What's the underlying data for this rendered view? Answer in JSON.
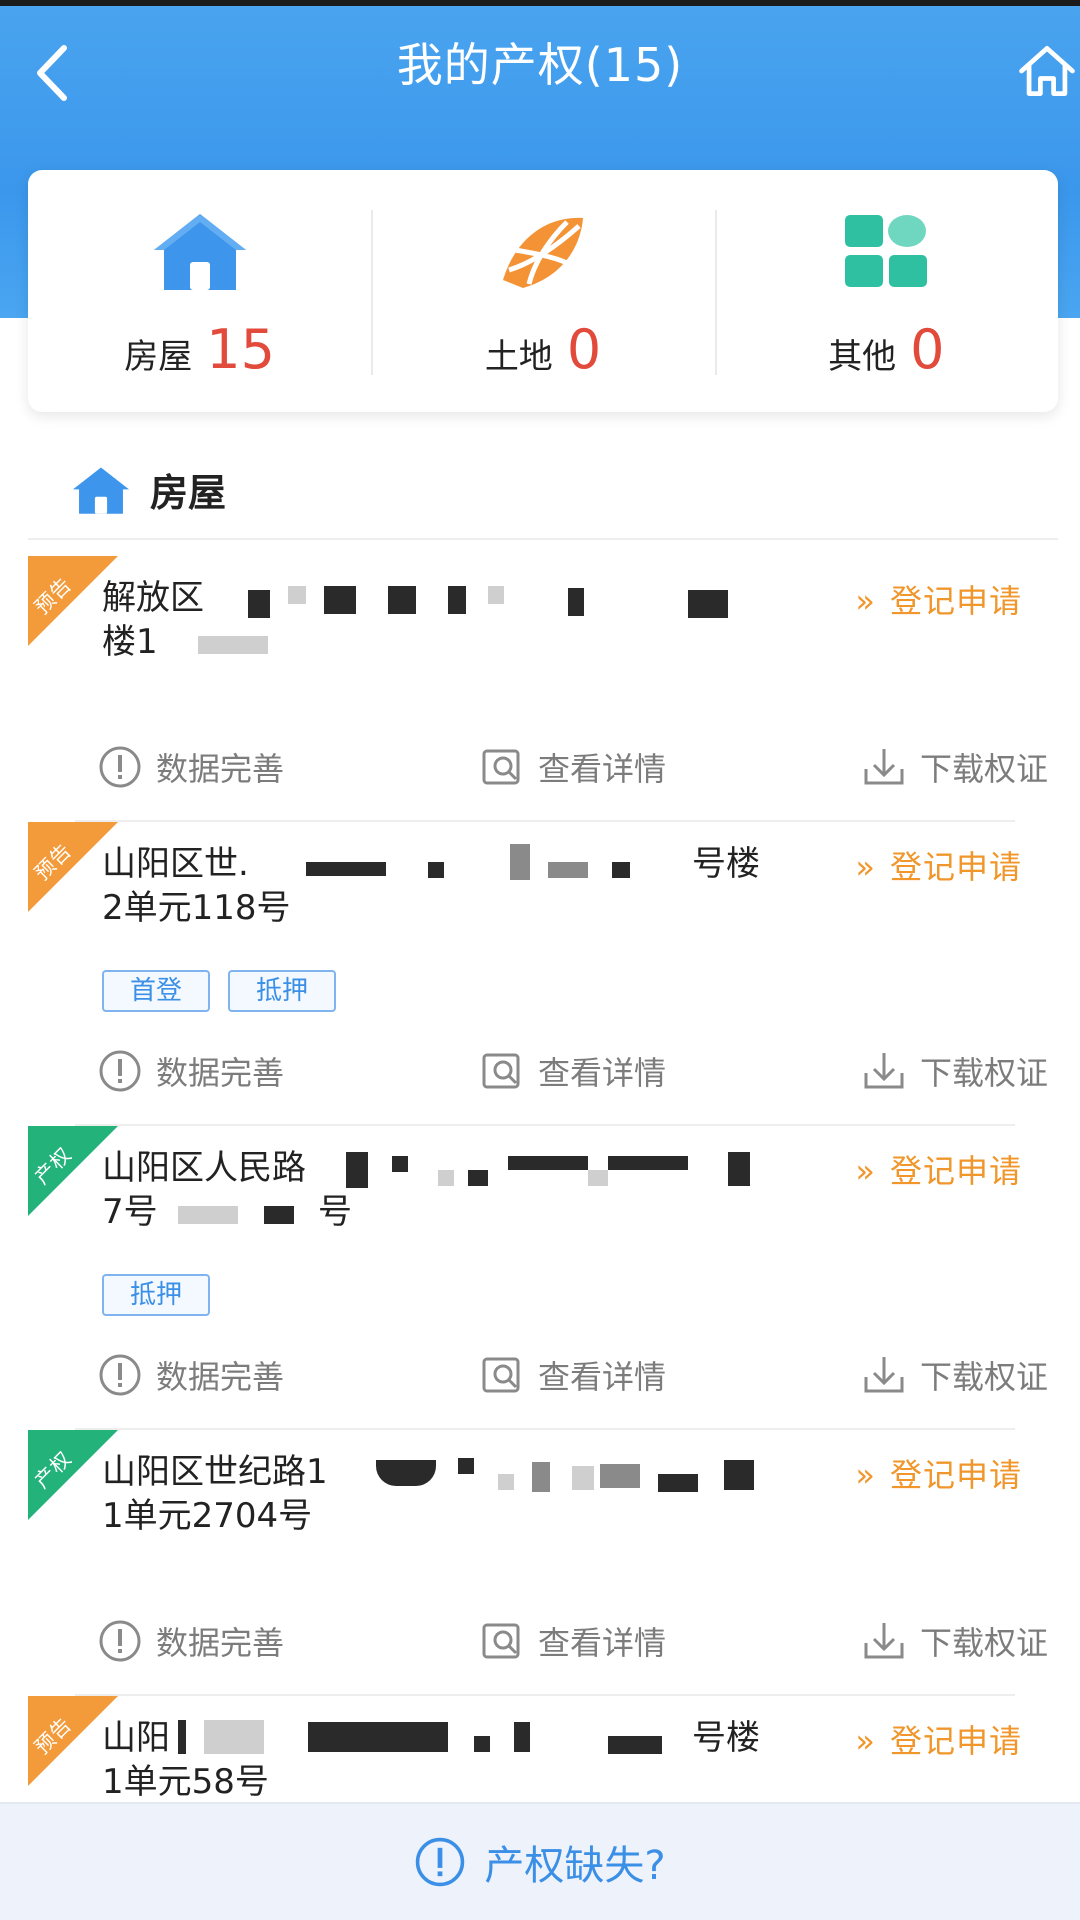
{
  "header": {
    "title": "我的产权(15)"
  },
  "summary": [
    {
      "label": "房屋",
      "count": "15",
      "icon": "house-icon"
    },
    {
      "label": "土地",
      "count": "0",
      "icon": "land-icon"
    },
    {
      "label": "其他",
      "count": "0",
      "icon": "grid-icon"
    }
  ],
  "section": {
    "title": "房屋"
  },
  "items": [
    {
      "badge": "预告",
      "badge_color": "#f39b3a",
      "line1": "解放区",
      "line2": "楼1",
      "tags": [],
      "apply": "登记申请"
    },
    {
      "badge": "预告",
      "badge_color": "#f39b3a",
      "line1": "山阳区世.",
      "line1_end": "号楼",
      "line2": "2单元118号",
      "tags": [
        "首登",
        "抵押"
      ],
      "apply": "登记申请"
    },
    {
      "badge": "产权",
      "badge_color": "#22b27a",
      "line1": "山阳区人民路",
      "line2": "7号",
      "line2_end": "号",
      "tags": [
        "抵押"
      ],
      "apply": "登记申请"
    },
    {
      "badge": "产权",
      "badge_color": "#22b27a",
      "line1": "山阳区世纪路1",
      "line2": "1单元2704号",
      "tags": [],
      "apply": "登记申请"
    },
    {
      "badge": "预告",
      "badge_color": "#f39b3a",
      "line1": "山阳",
      "line1_end": "号楼",
      "line2": "1单元58号",
      "tags": [],
      "apply": "登记申请"
    }
  ],
  "actions": {
    "data_complete": "数据完善",
    "view_detail": "查看详情",
    "download_cert": "下载权证"
  },
  "bottom": {
    "label": "产权缺失?"
  },
  "colors": {
    "header": "#3b97ec",
    "count": "#e24b3c",
    "apply": "#f0962b",
    "tag": "#3b8fe6"
  }
}
